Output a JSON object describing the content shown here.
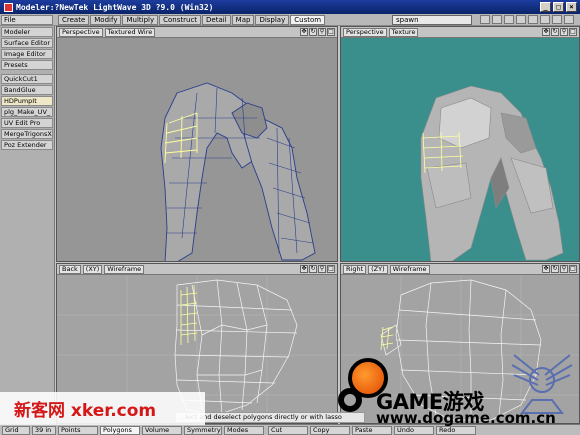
{
  "window": {
    "title": "Modeler:?NewTek LightWave 3D ?9.0 (Win32)",
    "buttons": [
      "_",
      "□",
      "×"
    ]
  },
  "menubar": {
    "file": "File",
    "tabs": [
      "Create",
      "Modify",
      "Multiply",
      "Construct",
      "Detail",
      "Map",
      "Display",
      "Custom"
    ],
    "active_tab": "Custom",
    "object_select": "spawn"
  },
  "sidebar": {
    "items": [
      "Modeler",
      "Surface Editor",
      "Image Editor",
      "Presets",
      "QuickCut1",
      "BandGlue",
      "HDPumpIt",
      "plg_Make_UV_",
      "UV Edit Pro",
      "MergeTrigonsX",
      "Poz Extender"
    ]
  },
  "viewports": {
    "top_left": {
      "view": "Perspective",
      "mode": "Textured Wire"
    },
    "top_right": {
      "view": "Perspective",
      "mode": "Texture"
    },
    "bottom_left": {
      "view": "Back",
      "axis": "(XY)",
      "mode": "Wireframe"
    },
    "bottom_right": {
      "view": "Right",
      "axis": "(ZY)",
      "mode": "Wireframe"
    }
  },
  "hint": "...lect and deselect polygons directly or with lasso",
  "statusbar": {
    "items": [
      "Grid",
      "39 in",
      "Points",
      "Polygons",
      "Volume",
      "Symmetry",
      "Modes",
      "Cut",
      "Copy",
      "Paste",
      "Undo",
      "Redo"
    ],
    "active": "Polygons"
  },
  "watermarks": {
    "left": "新客网 xker.com",
    "right_brand": "GAME游戏",
    "right_url": "www.dogame.com.cn"
  },
  "colors": {
    "viewport_bg": "#969696",
    "texture_bg": "#3a8f8c",
    "wire_blue": "#2a3e8c",
    "selected_yellow": "#ffffa0",
    "titlebar": "#0a246a"
  }
}
